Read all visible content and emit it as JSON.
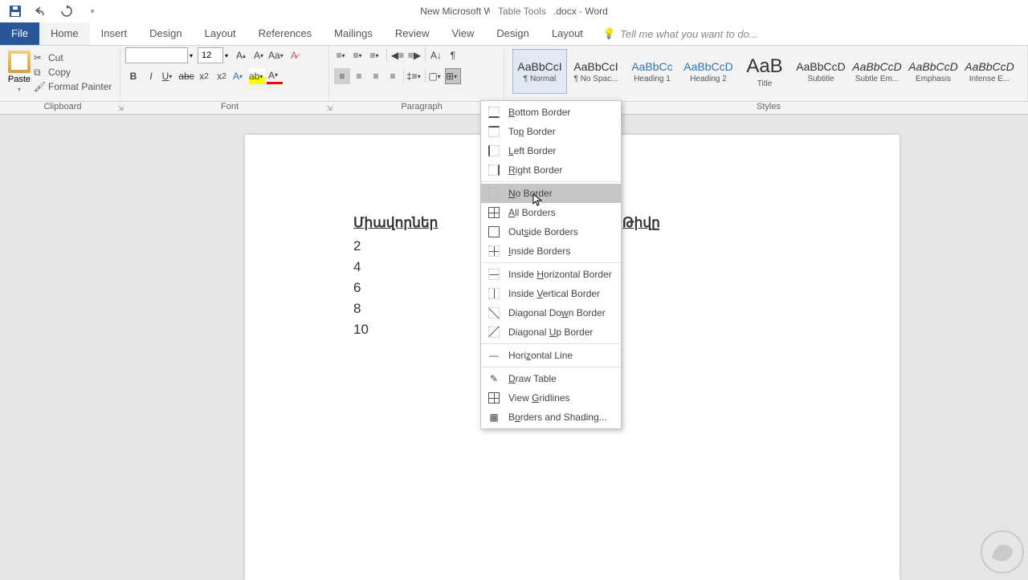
{
  "titlebar": {
    "title": "New Microsoft Word Document.docx - Word",
    "table_tools": "Table Tools"
  },
  "tabs": {
    "file": "File",
    "home": "Home",
    "insert": "Insert",
    "design": "Design",
    "layout": "Layout",
    "references": "References",
    "mailings": "Mailings",
    "review": "Review",
    "view": "View",
    "table_design": "Design",
    "table_layout": "Layout",
    "tell_me": "Tell me what you want to do..."
  },
  "clipboard": {
    "paste": "Paste",
    "cut": "Cut",
    "copy": "Copy",
    "format_painter": "Format Painter",
    "group": "Clipboard"
  },
  "font": {
    "size": "12",
    "group": "Font"
  },
  "paragraph": {
    "group": "Paragraph"
  },
  "styles": {
    "group": "Styles",
    "items": [
      {
        "preview": "AaBbCcI",
        "name": "¶ Normal",
        "cls": ""
      },
      {
        "preview": "AaBbCcI",
        "name": "¶ No Spac...",
        "cls": ""
      },
      {
        "preview": "AaBbCc",
        "name": "Heading 1",
        "cls": "blue"
      },
      {
        "preview": "AaBbCcD",
        "name": "Heading 2",
        "cls": "blue"
      },
      {
        "preview": "AaB",
        "name": "Title",
        "cls": "big"
      },
      {
        "preview": "AaBbCcD",
        "name": "Subtitle",
        "cls": ""
      },
      {
        "preview": "AaBbCcD",
        "name": "Subtle Em...",
        "cls": "italic"
      },
      {
        "preview": "AaBbCcD",
        "name": "Emphasis",
        "cls": "italic"
      },
      {
        "preview": "AaBbCcD",
        "name": "Intense E...",
        "cls": "italic"
      }
    ]
  },
  "doc": {
    "col1_header": "Միավորներ",
    "col2_header": "Թիվը",
    "rows": [
      "2",
      "4",
      "6",
      "8",
      "10"
    ]
  },
  "border_menu": {
    "bottom": "Bottom Border",
    "top": "Top Border",
    "left": "Left Border",
    "right": "Right Border",
    "no": "No Border",
    "all": "All Borders",
    "outside": "Outside Borders",
    "inside": "Inside Borders",
    "inside_h": "Inside Horizontal Border",
    "inside_v": "Inside Vertical Border",
    "diag_down": "Diagonal Down Border",
    "diag_up": "Diagonal Up Border",
    "hline": "Horizontal Line",
    "draw": "Draw Table",
    "gridlines": "View Gridlines",
    "shading": "Borders and Shading..."
  }
}
